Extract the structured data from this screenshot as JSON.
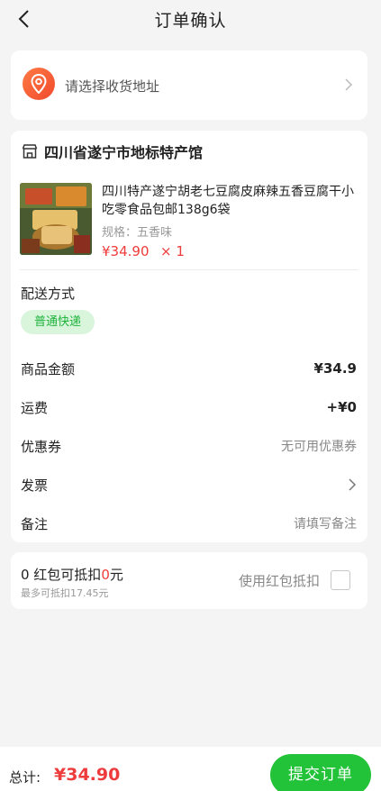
{
  "header": {
    "title": "订单确认"
  },
  "address": {
    "placeholder": "请选择收货地址"
  },
  "shop": {
    "name": "四川省遂宁市地标特产馆"
  },
  "product": {
    "title": "四川特产遂宁胡老七豆腐皮麻辣五香豆腐干小吃零食品包邮138g6袋",
    "spec": "规格：五香味",
    "price": "¥34.90",
    "qty": "× 1"
  },
  "shipping": {
    "label": "配送方式",
    "method": "普通快递"
  },
  "summary": {
    "amount_label": "商品金额",
    "amount_value": "¥34.9",
    "ship_label": "运费",
    "ship_value": "+¥0",
    "coupon_label": "优惠券",
    "coupon_value": "无可用优惠券",
    "invoice_label": "发票",
    "note_label": "备注",
    "note_placeholder": "请填写备注"
  },
  "red_packet": {
    "main_prefix": "0 红包可抵扣",
    "main_amount": "0",
    "main_suffix": "元",
    "sub": "最多可抵扣17.45元",
    "use_label": "使用红包抵扣",
    "checked": false
  },
  "bottom": {
    "total_label": "总计:",
    "total_amount": "¥34.90",
    "submit_label": "提交订单"
  },
  "colors": {
    "accent_green": "#22c339",
    "price_red": "#ee3b3b",
    "pin_orange": "#f04a2c"
  },
  "icons": {
    "back": "chevron-left-icon",
    "location": "location-pin-icon",
    "shop": "store-icon",
    "arrow": "chevron-right-icon"
  }
}
